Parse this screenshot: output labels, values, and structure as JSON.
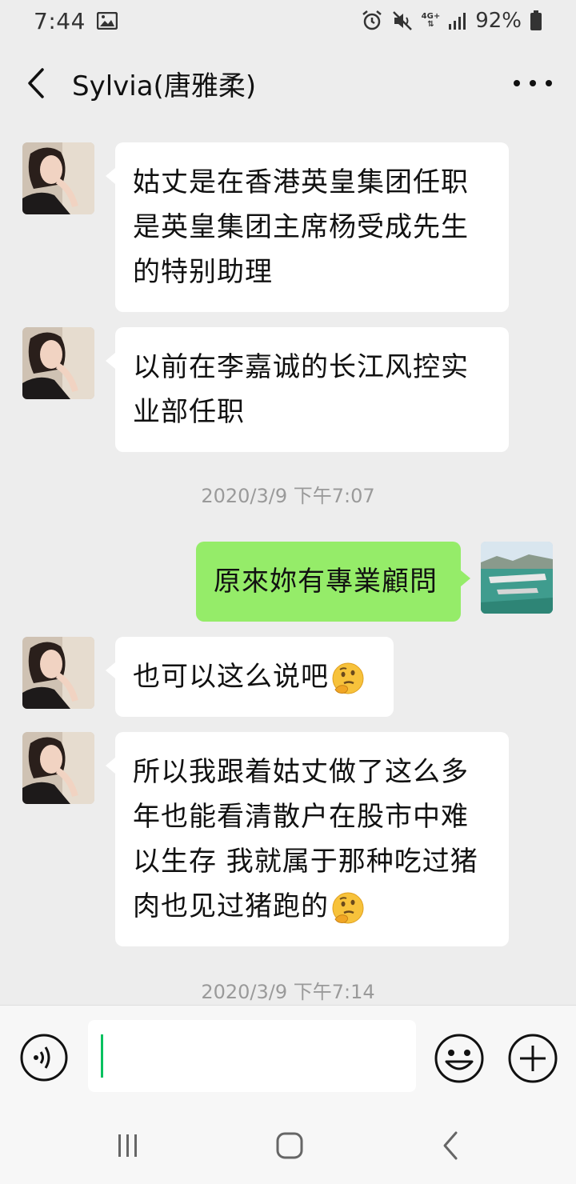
{
  "status_bar": {
    "time": "7:44",
    "network": "4G+",
    "battery": "92%"
  },
  "header": {
    "title": "Sylvia(唐雅柔)"
  },
  "messages": [
    {
      "sender": "Sylvia",
      "side": "left",
      "text": [
        "姑丈是在香港英皇集团任职",
        "是英皇集团主席杨受成先生",
        "的特别助理"
      ]
    },
    {
      "sender": "Sylvia",
      "side": "left",
      "text": [
        "以前在李嘉诚的长江风控实",
        "业部任职"
      ]
    },
    {
      "type": "timestamp",
      "text": "2020/3/9 下午7:07"
    },
    {
      "sender": "me",
      "side": "right",
      "text": [
        "原來妳有專業顧問"
      ]
    },
    {
      "sender": "Sylvia",
      "side": "left",
      "text": [
        "也可以这么说吧"
      ],
      "emoji": "thinking-face"
    },
    {
      "sender": "Sylvia",
      "side": "left",
      "text": [
        "所以我跟着姑丈做了这么多",
        "年也能看清散户在股市中难",
        "以生存 我就属于那种吃过猪",
        "肉也见过猪跑的"
      ],
      "emoji": "thinking-face"
    },
    {
      "type": "timestamp",
      "text": "2020/3/9 下午7:14"
    }
  ],
  "input_bar": {
    "value": ""
  },
  "colors": {
    "background": "#ededed",
    "incoming_bubble": "#ffffff",
    "outgoing_bubble": "#95ec69",
    "caret": "#07c160"
  }
}
